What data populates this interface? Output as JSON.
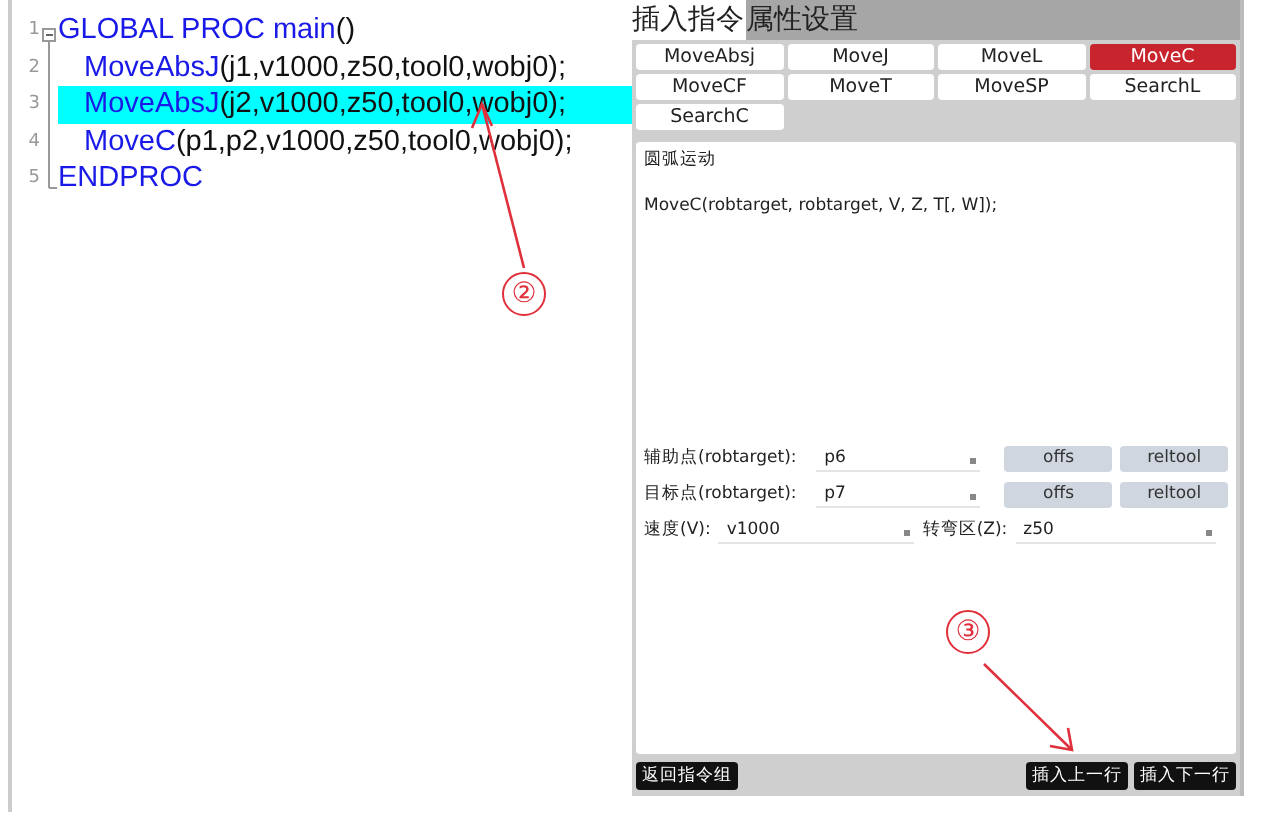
{
  "editor": {
    "lines": [
      {
        "number": "1",
        "selected": false,
        "segments": [
          {
            "text": "GLOBAL PROC main",
            "kind": "keyword"
          },
          {
            "text": "()",
            "kind": "plain"
          }
        ]
      },
      {
        "number": "2",
        "selected": false,
        "segments": [
          {
            "text": "MoveAbsJ",
            "kind": "keyword"
          },
          {
            "text": "(j1,v1000,z50,tool0,wobj0);",
            "kind": "plain"
          }
        ]
      },
      {
        "number": "3",
        "selected": true,
        "segments": [
          {
            "text": "MoveAbsJ",
            "kind": "keyword"
          },
          {
            "text": "(j2,v1000,z50,tool0,wobj0);",
            "kind": "plain"
          }
        ]
      },
      {
        "number": "4",
        "selected": false,
        "segments": [
          {
            "text": "MoveC",
            "kind": "keyword"
          },
          {
            "text": "(p1,p2,v1000,z50,tool0,wobj0);",
            "kind": "plain"
          }
        ]
      },
      {
        "number": "5",
        "selected": false,
        "segments": [
          {
            "text": "ENDPROC",
            "kind": "keyword"
          }
        ]
      }
    ]
  },
  "panel": {
    "title": "插入指令",
    "subtitle": "属性设置",
    "instructions": [
      {
        "label": "MoveAbsj",
        "selected": false
      },
      {
        "label": "MoveJ",
        "selected": false
      },
      {
        "label": "MoveL",
        "selected": false
      },
      {
        "label": "MoveC",
        "selected": true
      },
      {
        "label": "MoveCF",
        "selected": false
      },
      {
        "label": "MoveT",
        "selected": false
      },
      {
        "label": "MoveSP",
        "selected": false
      },
      {
        "label": "SearchL",
        "selected": false
      },
      {
        "label": "SearchC",
        "selected": false
      }
    ],
    "description": "圆弧运动",
    "syntax": "MoveC(robtarget, robtarget, V, Z, T[, W]);",
    "params": [
      {
        "label": "辅助点(robtarget):",
        "value": "p6",
        "buttons": [
          "offs",
          "reltool"
        ]
      },
      {
        "label": "目标点(robtarget):",
        "value": "p7",
        "buttons": [
          "offs",
          "reltool"
        ]
      }
    ],
    "speed": [
      {
        "label": "速度(V):",
        "value": "v1000"
      },
      {
        "label": "转弯区(Z):",
        "value": "z50"
      }
    ],
    "back_button": "返回指令组",
    "insert_buttons": [
      "插入上一行",
      "插入下一行"
    ]
  },
  "annotations": [
    {
      "label": "②"
    },
    {
      "label": "③"
    }
  ]
}
